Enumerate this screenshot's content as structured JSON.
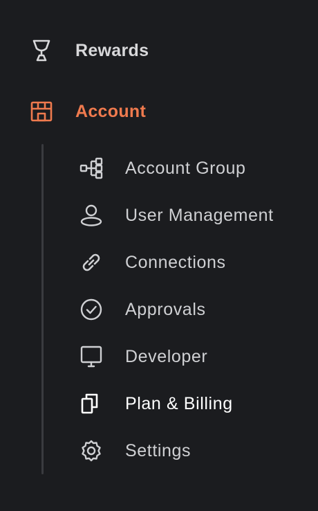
{
  "sidebar": {
    "top_items": [
      {
        "label": "Rewards",
        "icon": "trophy-icon"
      },
      {
        "label": "Account",
        "icon": "store-icon",
        "active": true
      }
    ],
    "account_subitems": [
      {
        "label": "Account Group",
        "icon": "hierarchy-icon"
      },
      {
        "label": "User Management",
        "icon": "user-icon"
      },
      {
        "label": "Connections",
        "icon": "link-icon"
      },
      {
        "label": "Approvals",
        "icon": "check-circle-icon"
      },
      {
        "label": "Developer",
        "icon": "monitor-icon"
      },
      {
        "label": "Plan & Billing",
        "icon": "copy-icon",
        "highlighted": true
      },
      {
        "label": "Settings",
        "icon": "gear-icon"
      }
    ]
  },
  "colors": {
    "background": "#1b1c1f",
    "accent": "#ef7a4e",
    "text": "#cfd0d3",
    "guide_line": "#3a3b3f"
  }
}
